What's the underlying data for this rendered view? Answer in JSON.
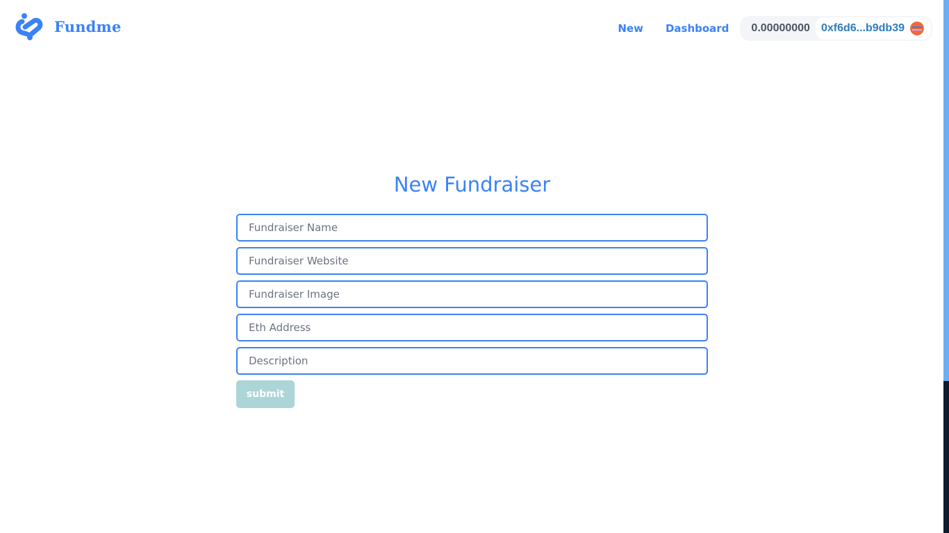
{
  "colors": {
    "primary": "#3b82f6",
    "field_border": "#3b82f6",
    "submit_bg": "#acd5d8",
    "submit_text": "#ffffff",
    "wallet_bg": "#f3f5f9",
    "address_chip_bg": "#ffffff",
    "balance_text": "#4b5563",
    "address_text": "#2f7dbb",
    "avatar": "#ef6a3b",
    "scroll_upper": "#6aaef6",
    "scroll_lower": "#0d1a2f"
  },
  "brand": {
    "name": "Fundme",
    "logo_icon": "fundme-logo-icon"
  },
  "nav": {
    "new_label": "New",
    "dashboard_label": "Dashboard"
  },
  "wallet": {
    "balance": "0.00000000",
    "address": "0xf6d6...b9db39",
    "avatar_icon": "wallet-avatar-icon"
  },
  "form": {
    "title": "New Fundraiser",
    "fields": [
      {
        "placeholder": "Fundraiser Name",
        "value": ""
      },
      {
        "placeholder": "Fundraiser Website",
        "value": ""
      },
      {
        "placeholder": "Fundraiser Image",
        "value": ""
      },
      {
        "placeholder": "Eth Address",
        "value": ""
      },
      {
        "placeholder": "Description",
        "value": ""
      }
    ],
    "submit_label": "submit"
  }
}
